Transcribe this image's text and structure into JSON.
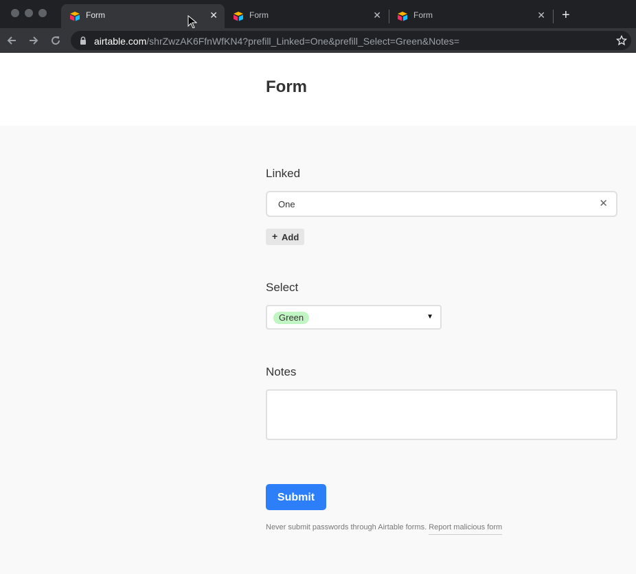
{
  "browser": {
    "tabs": [
      {
        "title": "Form",
        "active": true
      },
      {
        "title": "Form",
        "active": false
      },
      {
        "title": "Form",
        "active": false
      }
    ],
    "new_tab_symbol": "+",
    "close_symbol": "✕",
    "url_host": "airtable.com",
    "url_path": "/shrZwzAK6FfnWfKN4?prefill_Linked=One&prefill_Select=Green&Notes="
  },
  "page": {
    "title": "Form"
  },
  "form": {
    "linked": {
      "label": "Linked",
      "value": "One",
      "remove_symbol": "✕",
      "add_symbol": "+",
      "add_label": "Add"
    },
    "select": {
      "label": "Select",
      "value": "Green",
      "value_color": "#c2f5c4",
      "caret": "▼"
    },
    "notes": {
      "label": "Notes",
      "value": ""
    },
    "submit_label": "Submit",
    "footer_note": "Never submit passwords through Airtable forms.",
    "report_link": "Report malicious form"
  },
  "colors": {
    "accent": "#2d7ff9",
    "select_pill": "#c2f5c4"
  },
  "icons": [
    "airtable-logo-icon",
    "back-arrow-icon",
    "forward-arrow-icon",
    "reload-icon",
    "lock-icon",
    "star-icon",
    "close-icon",
    "plus-icon",
    "chevron-down-icon",
    "mouse-cursor-icon"
  ]
}
